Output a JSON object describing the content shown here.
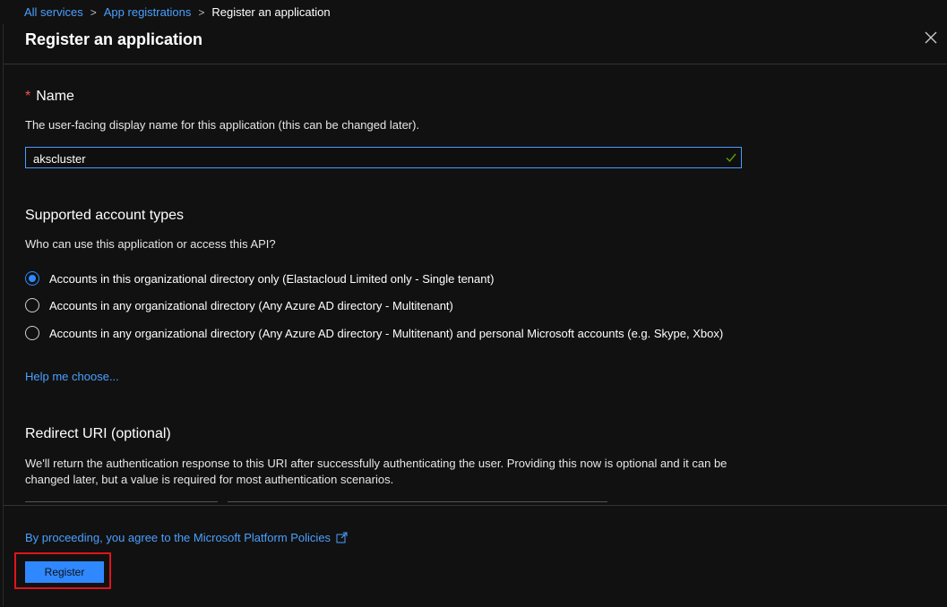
{
  "breadcrumb": {
    "items": [
      "All services",
      "App registrations"
    ],
    "current": "Register an application"
  },
  "panel": {
    "title": "Register an application",
    "close_icon": "close-icon"
  },
  "name_section": {
    "required_mark": "*",
    "title": "Name",
    "description": "The user-facing display name for this application (this can be changed later).",
    "input_value": "akscluster",
    "valid_icon": "checkmark-icon"
  },
  "account_types": {
    "title": "Supported account types",
    "question": "Who can use this application or access this API?",
    "options": [
      {
        "label": "Accounts in this organizational directory only (Elastacloud Limited only - Single tenant)",
        "selected": true
      },
      {
        "label": "Accounts in any organizational directory (Any Azure AD directory - Multitenant)",
        "selected": false
      },
      {
        "label": "Accounts in any organizational directory (Any Azure AD directory - Multitenant) and personal Microsoft accounts (e.g. Skype, Xbox)",
        "selected": false
      }
    ],
    "help_link": "Help me choose..."
  },
  "redirect": {
    "title": "Redirect URI (optional)",
    "description_line1": "We'll return the authentication response to this URI after successfully authenticating the user. Providing this now is optional and it can be",
    "description_line2": "changed later, but a value is required for most authentication scenarios."
  },
  "footer": {
    "policy_text": "By proceeding, you agree to the Microsoft Platform Policies",
    "external_icon": "external-link-icon",
    "register_label": "Register"
  },
  "colors": {
    "accent": "#2f88ff",
    "link": "#4aa0ff",
    "highlight": "#e2141a",
    "required": "#ff4d4d",
    "valid": "#57a300"
  }
}
